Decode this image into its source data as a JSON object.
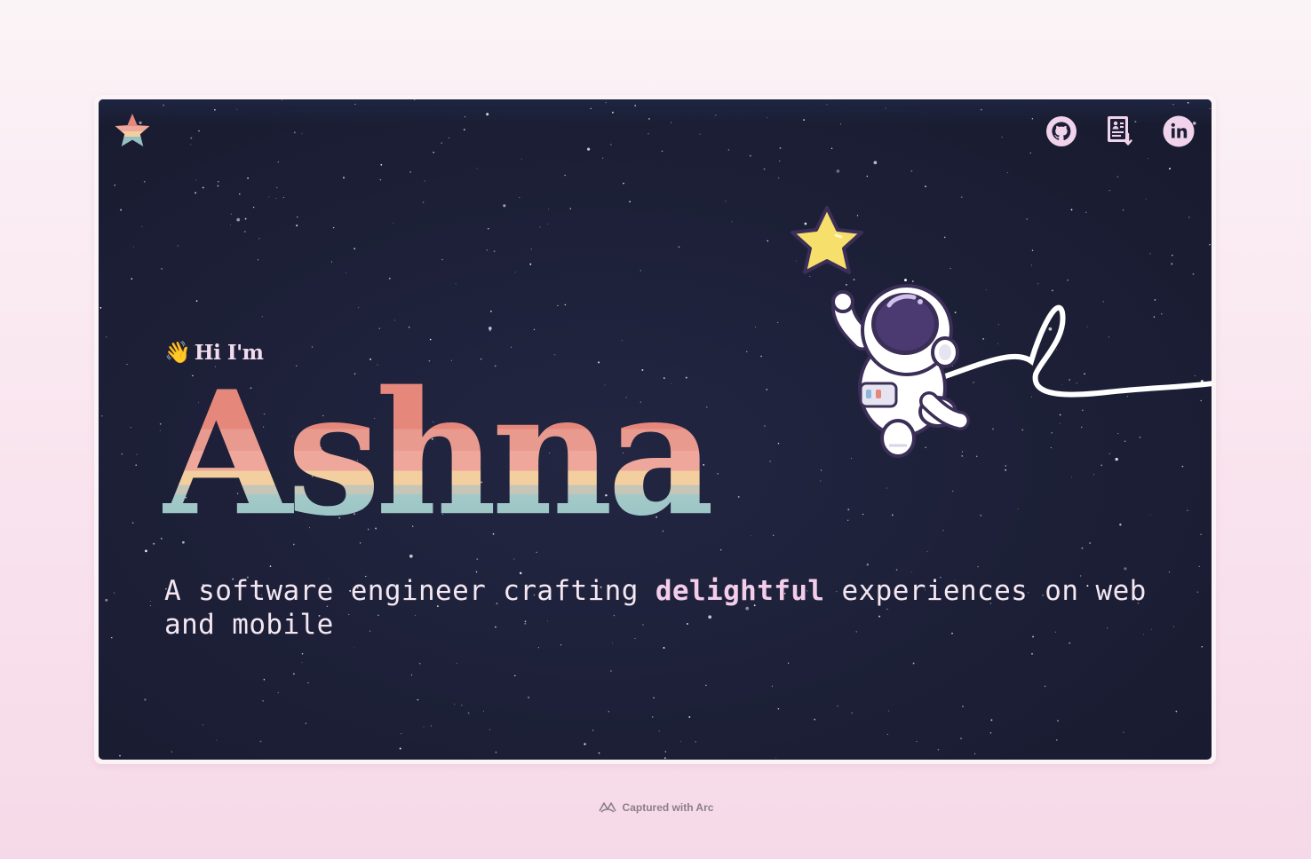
{
  "hero": {
    "greeting_emoji": "👋",
    "greeting": "Hi I'm",
    "name": "Ashna",
    "tagline_before": "A software engineer crafting ",
    "tagline_highlight": "delightful",
    "tagline_after": " experiences on web and mobile"
  },
  "nav": {
    "icons": [
      "github-icon",
      "resume-download-icon",
      "linkedin-icon"
    ]
  },
  "footer": {
    "caption": "Captured with Arc"
  },
  "colors": {
    "background": "#1c1f36",
    "page_bg": "#f9e4ee",
    "name_coral": "#e6877b",
    "name_peach": "#eea79a",
    "name_yellow": "#f3cf9f",
    "name_teal": "#95c1c2",
    "tagline": "#f4e7f2",
    "highlight": "#f3cdea",
    "icon_fill": "#f1d3ec",
    "star_yellow": "#f7df6b"
  }
}
